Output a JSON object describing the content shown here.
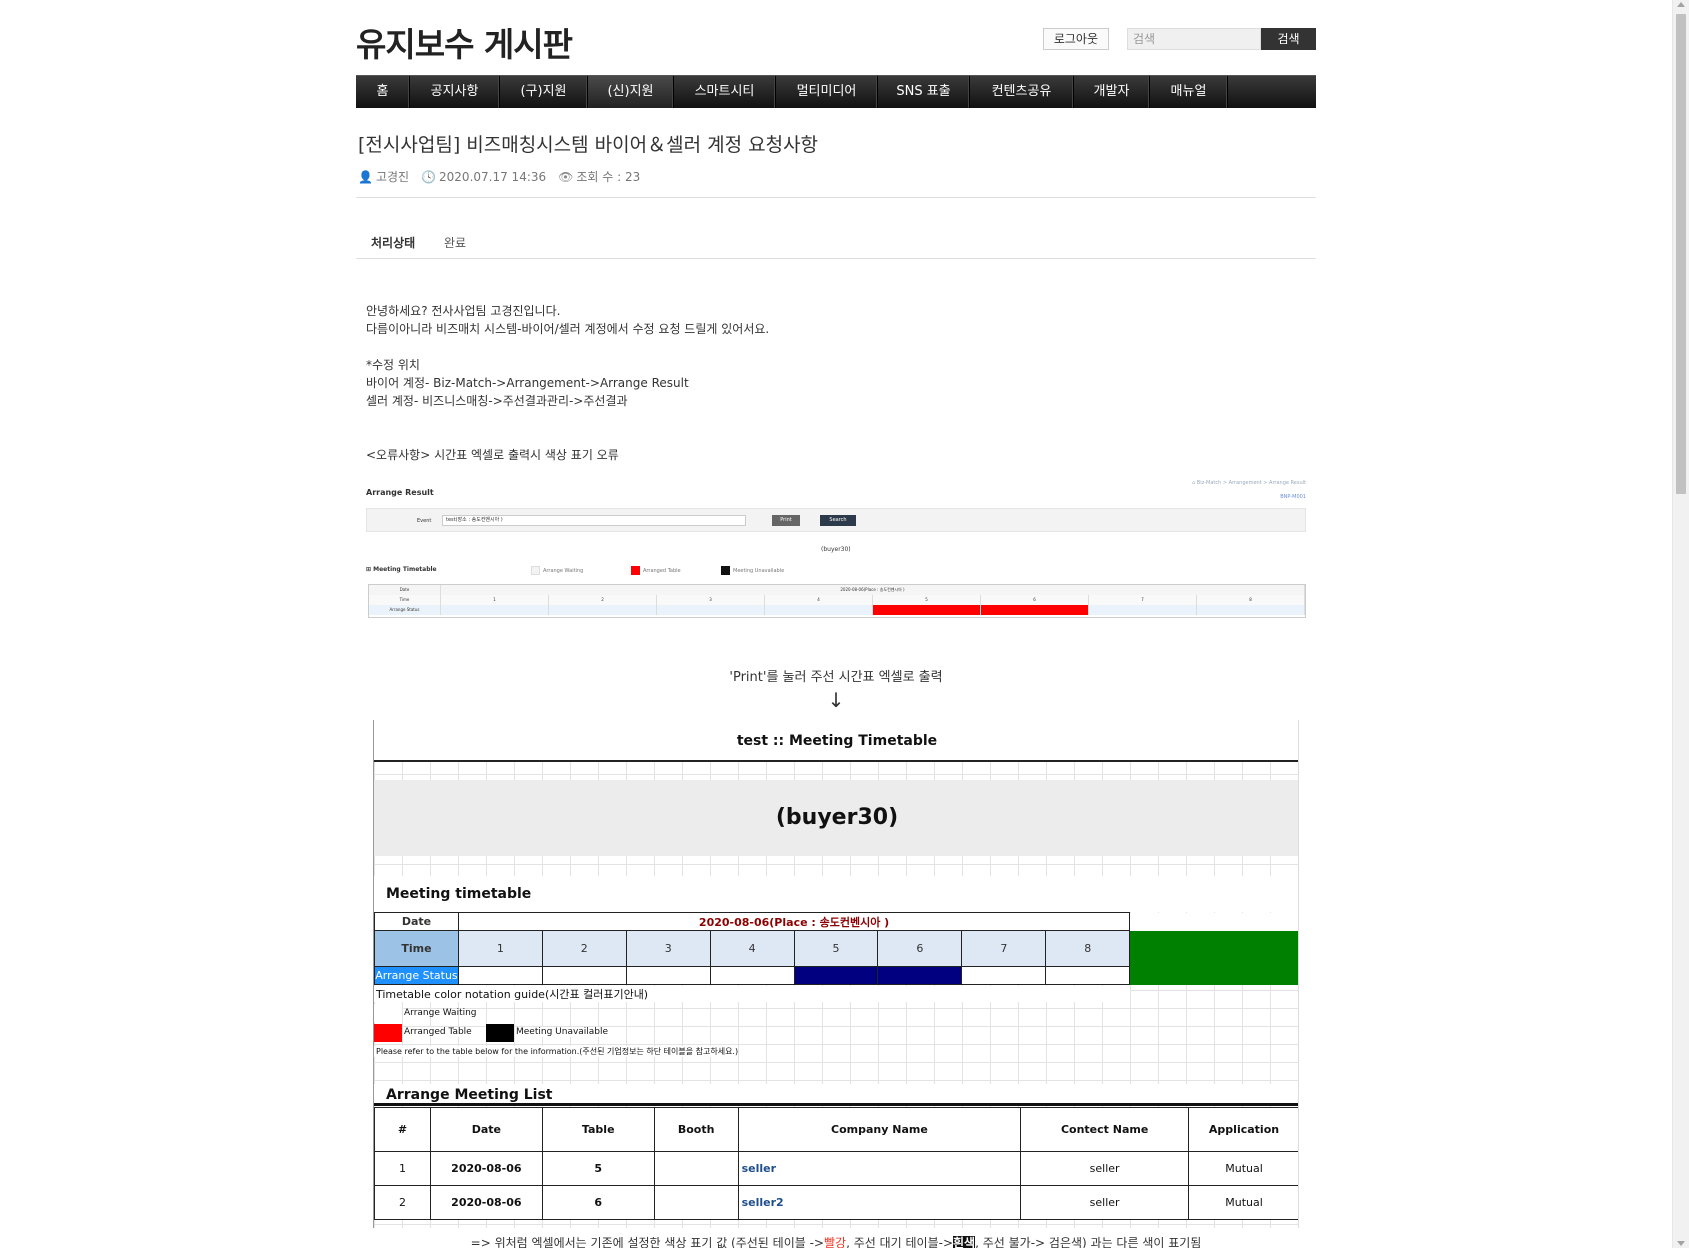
{
  "site": {
    "title": "유지보수 게시판",
    "logout": "로그아웃",
    "search_placeholder": "검색",
    "search_btn": "검색"
  },
  "nav": [
    "홈",
    "공지사항",
    "(구)지원",
    "(신)지원",
    "스마트시티",
    "멀티미디어",
    "SNS 표출",
    "컨텐츠공유",
    "개발자",
    "매뉴얼"
  ],
  "post": {
    "title": "[전시사업팀] 비즈매칭시스템 바이어＆셀러 계정 요청사항",
    "author": "고경진",
    "date": "2020.07.17 14:36",
    "views": "조회 수 : 23",
    "status_label": "처리상태",
    "status_value": "완료"
  },
  "body": {
    "lines1": [
      "안녕하세요? 전사사업팀 고경진입니다.",
      "다름이아니라 비즈매치 시스템-바이어/셀러 계정에서 수정 요청 드릴게 있어서요."
    ],
    "lines2": [
      "*수정 위치",
      "바이어 계정- Biz-Match->Arrangement->Arrange Result",
      "셀러 계정- 비즈니스매칭->주선결과관리->주선결과"
    ],
    "error": "<오류사항> 시간표 엑셀로 출력시 색상 표기 오류",
    "caption": "'Print'를 눌러 주선 시간표 엑셀로 출력",
    "arrow": "↓",
    "note_a": "=> 위처럼 엑셀에서는 기존에 설정한 색상 표기 값 (주선된 테이블 ->",
    "note_red": "빨강",
    "note_b": ", 주선 대기 테이블->",
    "note_hl": "흰색",
    "note_c": ", 주선 불가-> 검은색) 과는 다른 색이 표기됨"
  },
  "shot1": {
    "title": "Arrange Result",
    "breadcrumb": "⌂  Biz-Match  >  Arrangement  >  Arrange Result",
    "code": "BNP-M001",
    "event_label": "Event",
    "event_value": "test(장소 : 송도컨벤시아 )",
    "print": "Print",
    "search": "Search",
    "buyer": "(buyer30)",
    "mt": "Meeting Timetable",
    "lg_waiting": "Arrange Waiting",
    "lg_arranged": "Arranged Table",
    "lg_unavail": "Meeting Unavailable",
    "row_date": "Date",
    "row_date_val": "2020-08-06(Place : 송도컨벤시아 )",
    "row_time": "Time",
    "row_status": "Arrange Status",
    "slots": [
      "1",
      "2",
      "3",
      "4",
      "5",
      "6",
      "7",
      "8"
    ],
    "arranged_slots": [
      5,
      6
    ]
  },
  "excel": {
    "title": "test :: Meeting Timetable",
    "buyer": "(buyer30)",
    "mt": "Meeting timetable",
    "date_label": "Date",
    "date_value": "2020-08-06(Place : 송도컨벤시아 )",
    "time_label": "Time",
    "slots": [
      "1",
      "2",
      "3",
      "4",
      "5",
      "6",
      "7",
      "8"
    ],
    "status_label": "Arrange Status",
    "arranged_slots": [
      5,
      6
    ],
    "guide": "Timetable color notation guide(시간표 컬러표기안내)",
    "lg_waiting": "Arrange Waiting",
    "lg_arranged": "Arranged Table",
    "lg_unavail": "Meeting Unavailable",
    "refer": "Please refer to the table below for the information.(주선된 기업정보는 하단 테이블을 참고하세요.)",
    "aml": "Arrange Meeting List",
    "headers": [
      "#",
      "Date",
      "Table",
      "Booth",
      "Company Name",
      "Contect Name",
      "Application"
    ],
    "rows": [
      [
        "1",
        "2020-08-06",
        "5",
        "",
        "seller",
        "seller",
        "Mutual"
      ],
      [
        "2",
        "2020-08-06",
        "6",
        "",
        "seller2",
        "seller",
        "Mutual"
      ]
    ]
  },
  "colors": {
    "arranged_web": "#ff0000",
    "arranged_excel": "#000080",
    "unavail_excel": "#008000",
    "time_header": "#9cc3e6",
    "status_header": "#1e90ff"
  }
}
